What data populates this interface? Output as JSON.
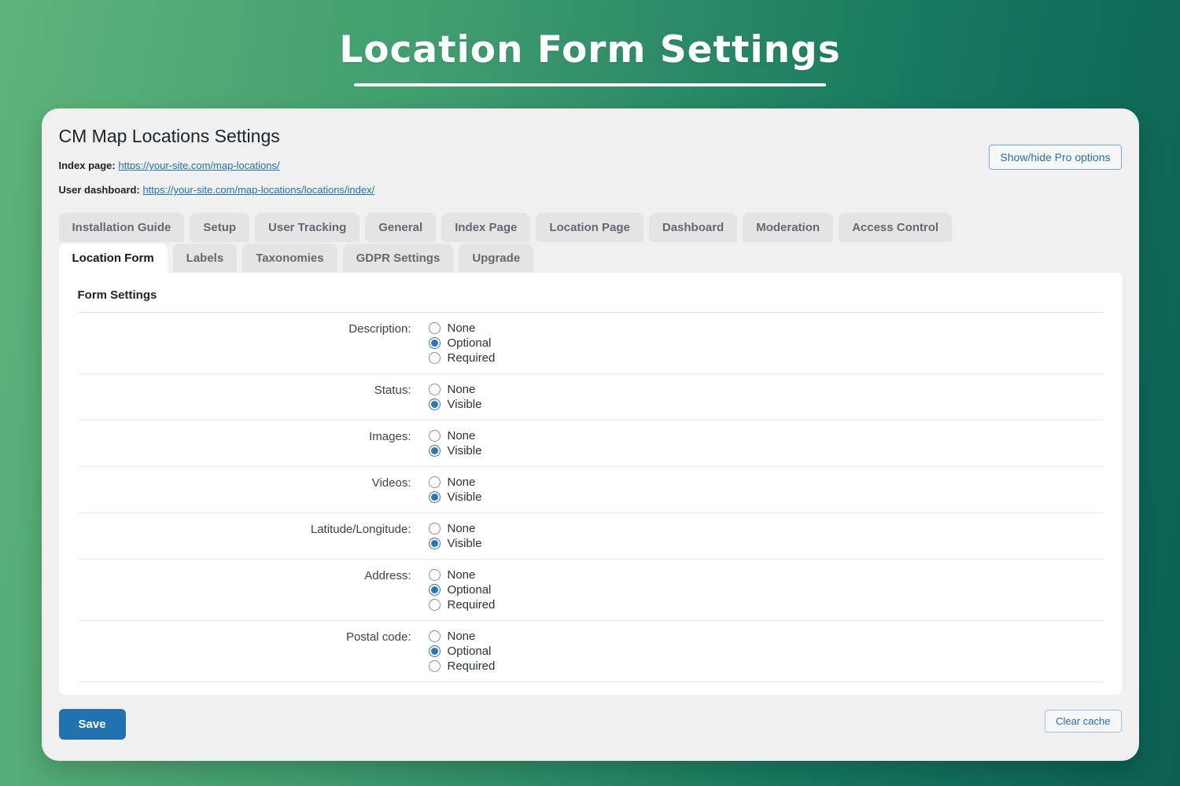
{
  "page_title": "Location Form Settings",
  "card": {
    "title": "CM Map Locations Settings",
    "pro_button_label": "Show/hide Pro options",
    "links": [
      {
        "label": "Index page:",
        "url": "https://your-site.com/map-locations/"
      },
      {
        "label": "User dashboard:",
        "url": "https://your-site.com/map-locations/locations/index/"
      }
    ],
    "tabs_row1": [
      {
        "label": "Installation Guide"
      },
      {
        "label": "Setup"
      },
      {
        "label": "User Tracking"
      },
      {
        "label": "General"
      },
      {
        "label": "Index Page"
      },
      {
        "label": "Location Page"
      },
      {
        "label": "Dashboard"
      },
      {
        "label": "Moderation"
      },
      {
        "label": "Access Control"
      }
    ],
    "tabs_row2": [
      {
        "label": "Location Form",
        "active": true
      },
      {
        "label": "Labels"
      },
      {
        "label": "Taxonomies"
      },
      {
        "label": "GDPR Settings"
      },
      {
        "label": "Upgrade"
      }
    ],
    "panel": {
      "section_title": "Form Settings",
      "rows": [
        {
          "label": "Description:",
          "options": [
            "None",
            "Optional",
            "Required"
          ],
          "selected": 1
        },
        {
          "label": "Status:",
          "options": [
            "None",
            "Visible"
          ],
          "selected": 1
        },
        {
          "label": "Images:",
          "options": [
            "None",
            "Visible"
          ],
          "selected": 1
        },
        {
          "label": "Videos:",
          "options": [
            "None",
            "Visible"
          ],
          "selected": 1
        },
        {
          "label": "Latitude/Longitude:",
          "options": [
            "None",
            "Visible"
          ],
          "selected": 1
        },
        {
          "label": "Address:",
          "options": [
            "None",
            "Optional",
            "Required"
          ],
          "selected": 1
        },
        {
          "label": "Postal code:",
          "options": [
            "None",
            "Optional",
            "Required"
          ],
          "selected": 1
        }
      ]
    },
    "save_button_label": "Save",
    "clear_cache_button_label": "Clear cache"
  },
  "colors": {
    "background_gradient_start": "#5eb47a",
    "background_gradient_end": "#0b6052",
    "card_background": "#f0f0f1",
    "tab_background": "#e4e4e5",
    "active_tab_background": "#ffffff",
    "panel_background": "#ffffff",
    "accent_blue": "#2271b1",
    "radio_selected_blue": "#2b77b5",
    "save_button_background": "#2271b1",
    "title_text": "#ffffff"
  }
}
